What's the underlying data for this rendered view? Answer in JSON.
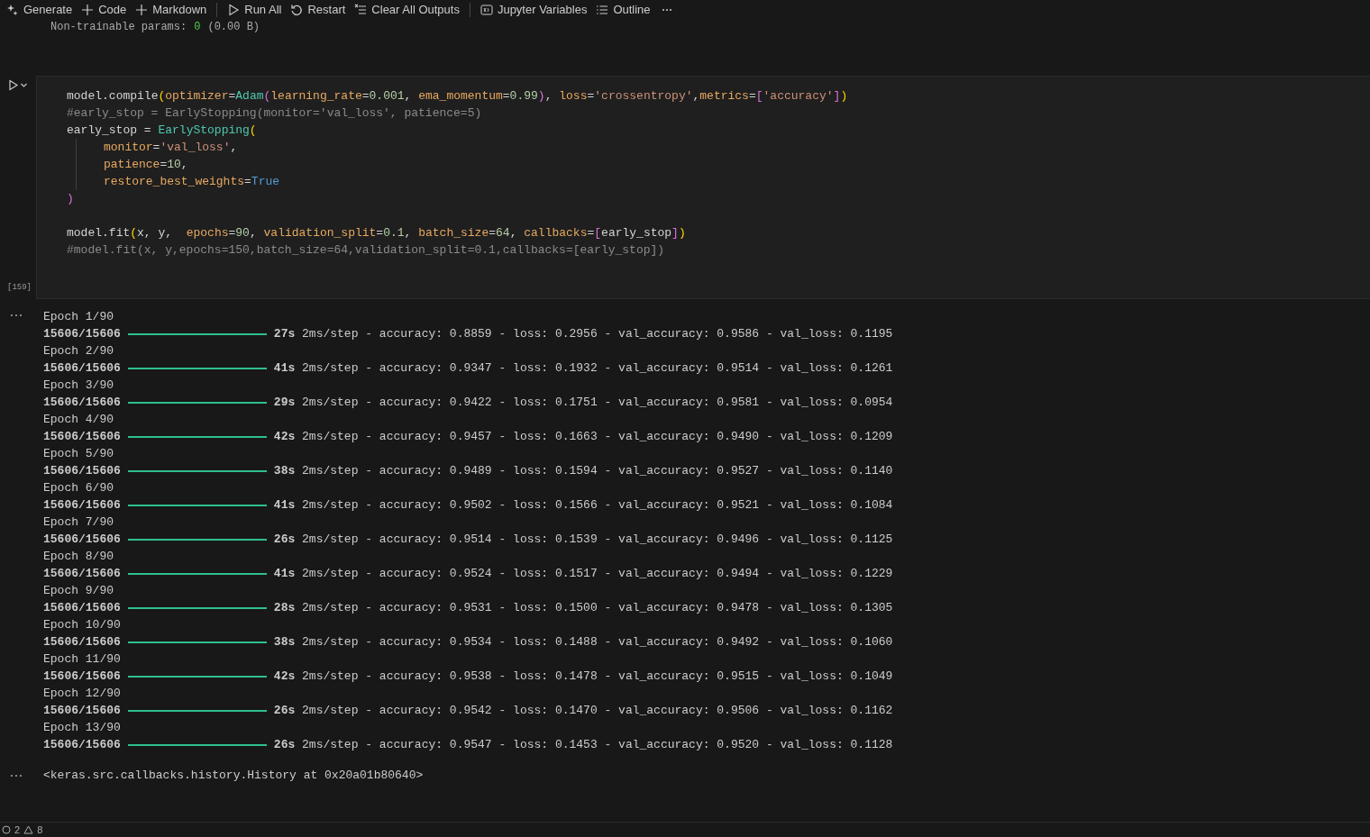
{
  "toolbar": [
    {
      "label": "Generate"
    },
    {
      "label": "Code"
    },
    {
      "label": "Markdown"
    },
    {
      "label": "Run All"
    },
    {
      "label": "Restart"
    },
    {
      "label": "Clear All Outputs"
    },
    {
      "label": "Jupyter Variables"
    },
    {
      "label": "Outline"
    }
  ],
  "previous_output": {
    "label": "Non-trainable params:",
    "value": "0",
    "size": "(0.00 B)"
  },
  "cell": {
    "execution_count": "[159]",
    "blocks": [
      [
        "model.compile(optimizer=Adam(learning_rate=0.001, ema_momentum=0.99), loss='crossentropy',metrics=['accuracy'])",
        "#early_stop = EarlyStopping(monitor='val_loss', patience=5)",
        "early_stop = EarlyStopping(",
        "    monitor='val_loss',",
        "    patience=10,",
        "    restore_best_weights=True",
        ")"
      ],
      [
        "model.fit(x, y,  epochs=90, validation_split=0.1, batch_size=64, callbacks=[early_stop])",
        "#model.fit(x, y,epochs=150,batch_size=64,validation_split=0.1,callbacks=[early_stop])"
      ]
    ]
  },
  "output": {
    "epochs": [
      {
        "epoch": "Epoch 1/90",
        "step": "15606/15606",
        "level": 1,
        "stats": "**27s** 2ms/step - accuracy: 0.8859 - loss: 0.2956 - val_accuracy: 0.9586 - val_loss: 0.1195"
      },
      {
        "epoch": "Epoch 2/90",
        "step": "15606/15606",
        "level": 1,
        "stats": "**41s** 2ms/step - accuracy: 0.9347 - loss: 0.1932 - val_accuracy: 0.9514 - val_loss: 0.1261"
      },
      {
        "epoch": "Epoch 3/90",
        "step": "15606/15606",
        "level": 1,
        "stats": "**29s** 2ms/step - accuracy: 0.9422 - loss: 0.1751 - val_accuracy: 0.9581 - val_loss: 0.0954"
      },
      {
        "epoch": "Epoch 4/90",
        "step": "15606/15606",
        "level": 1,
        "stats": "**42s** 2ms/step - accuracy: 0.9457 - loss: 0.1663 - val_accuracy: 0.9490 - val_loss: 0.1209"
      },
      {
        "epoch": "Epoch 5/90",
        "step": "15606/15606",
        "level": 1,
        "stats": "**38s** 2ms/step - accuracy: 0.9489 - loss: 0.1594 - val_accuracy: 0.9527 - val_loss: 0.1140"
      },
      {
        "epoch": "Epoch 6/90",
        "step": "15606/15606",
        "level": 1,
        "stats": "**41s** 2ms/step - accuracy: 0.9502 - loss: 0.1566 - val_accuracy: 0.9521 - val_loss: 0.1084"
      },
      {
        "epoch": "Epoch 7/90",
        "step": "15606/15606",
        "level": 1,
        "stats": "**26s** 2ms/step - accuracy: 0.9514 - loss: 0.1539 - val_accuracy: 0.9496 - val_loss: 0.1125"
      },
      {
        "epoch": "Epoch 8/90",
        "step": "15606/15606",
        "level": 1,
        "stats": "**41s** 2ms/step - accuracy: 0.9524 - loss: 0.1517 - val_accuracy: 0.9494 - val_loss: 0.1229"
      },
      {
        "epoch": "Epoch 9/90",
        "step": "15606/15606",
        "level": 1,
        "stats": "**28s** 2ms/step - accuracy: 0.9531 - loss: 0.1500 - val_accuracy: 0.9478 - val_loss: 0.1305"
      },
      {
        "epoch": "Epoch 10/90",
        "step": "15606/15606",
        "level": 1,
        "stats": "**38s** 2ms/step - accuracy: 0.9534 - loss: 0.1488 - val_accuracy: 0.9492 - val_loss: 0.1060"
      },
      {
        "epoch": "Epoch 11/90",
        "step": "15606/15606",
        "level": 1,
        "stats": "**42s** 2ms/step - accuracy: 0.9538 - loss: 0.1478 - val_accuracy: 0.9515 - val_loss: 0.1049"
      },
      {
        "epoch": "Epoch 12/90",
        "step": "15606/15606",
        "level": 1,
        "stats": "**26s** 2ms/step - accuracy: 0.9542 - loss: 0.1470 - val_accuracy: 0.9506 - val_loss: 0.1162"
      },
      {
        "epoch": "Epoch 13/90",
        "step": "15606/15606",
        "level": 1,
        "stats": "**26s** 2ms/step - accuracy: 0.9547 - loss: 0.1453 - val_accuracy: 0.9520 - val_loss: 0.1128"
      }
    ],
    "result": "<keras.src.callbacks.history.History at 0x20a01b80640>"
  },
  "status_bar": {
    "errors": "2",
    "warnings": "8"
  }
}
